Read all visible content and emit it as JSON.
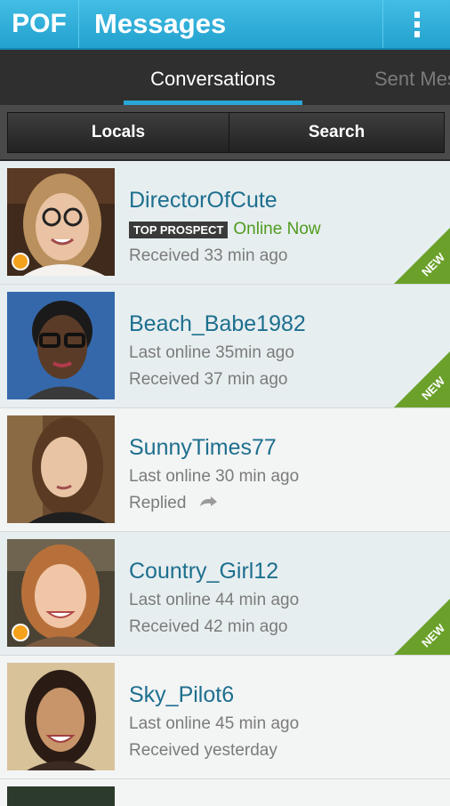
{
  "app": {
    "logo": "POF",
    "title": "Messages"
  },
  "tabs": {
    "active": "Conversations",
    "next": "Sent Messages"
  },
  "buttons": {
    "locals": "Locals",
    "search": "Search"
  },
  "badges": {
    "new": "NEW",
    "top_prospect": "TOP PROSPECT"
  },
  "conversations": [
    {
      "name": "DirectorOfCute",
      "line2": "Online Now",
      "line3": "Received 33 min ago"
    },
    {
      "name": "Beach_Babe1982",
      "line2": "Last online 35min ago",
      "line3": "Received 37 min ago"
    },
    {
      "name": "SunnyTimes77",
      "line2": "Last online 30 min ago",
      "line3": "Replied"
    },
    {
      "name": "Country_Girl12",
      "line2": "Last online 44 min ago",
      "line3": "Received 42 min ago"
    },
    {
      "name": "Sky_Pilot6",
      "line2": "Last online 45 min ago",
      "line3": "Received yesterday"
    }
  ],
  "colors": {
    "header": "#22a2cf",
    "accent_tab": "#29a8d8",
    "name": "#1d6f8e",
    "online": "#4f9b1f",
    "new_flag": "#6ba12a",
    "status_dot": "#f4a21c"
  }
}
